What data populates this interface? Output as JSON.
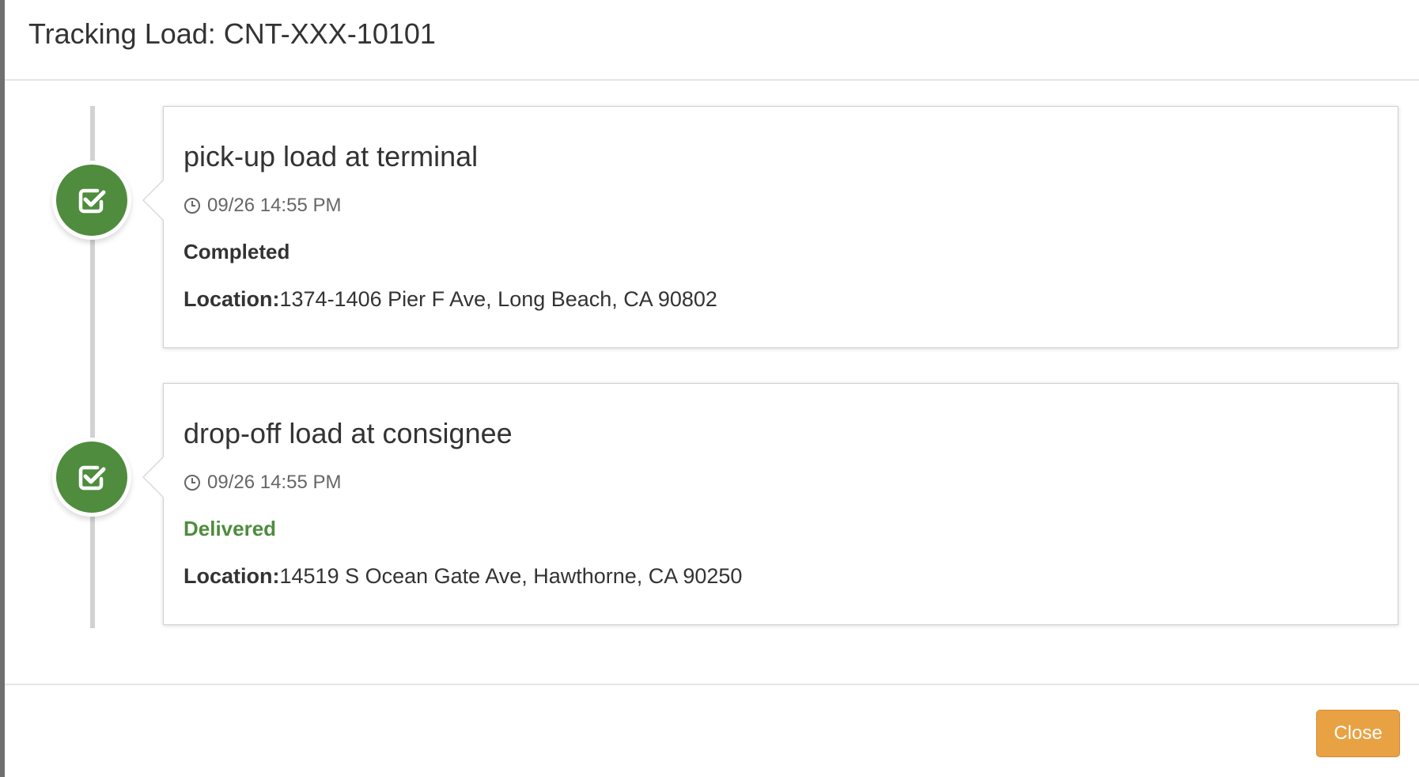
{
  "modal": {
    "title": "Tracking Load: CNT-XXX-10101"
  },
  "events": [
    {
      "icon": "check-square-icon",
      "title": "pick-up load at terminal",
      "time": "09/26 14:55 PM",
      "status": "Completed",
      "location_label": "Location:",
      "location": "1374-1406 Pier F Ave, Long Beach, CA 90802"
    },
    {
      "icon": "check-square-icon",
      "title": "drop-off load at consignee",
      "time": "09/26 14:55 PM",
      "status": "Delivered",
      "location_label": "Location:",
      "location": "14519 S Ocean Gate Ave, Hawthorne, CA 90250"
    }
  ],
  "footer": {
    "close_label": "Close"
  },
  "colors": {
    "badge_green": "#4f8c3e",
    "delivered_green": "#4f8c3e",
    "close_button": "#e9a243"
  }
}
